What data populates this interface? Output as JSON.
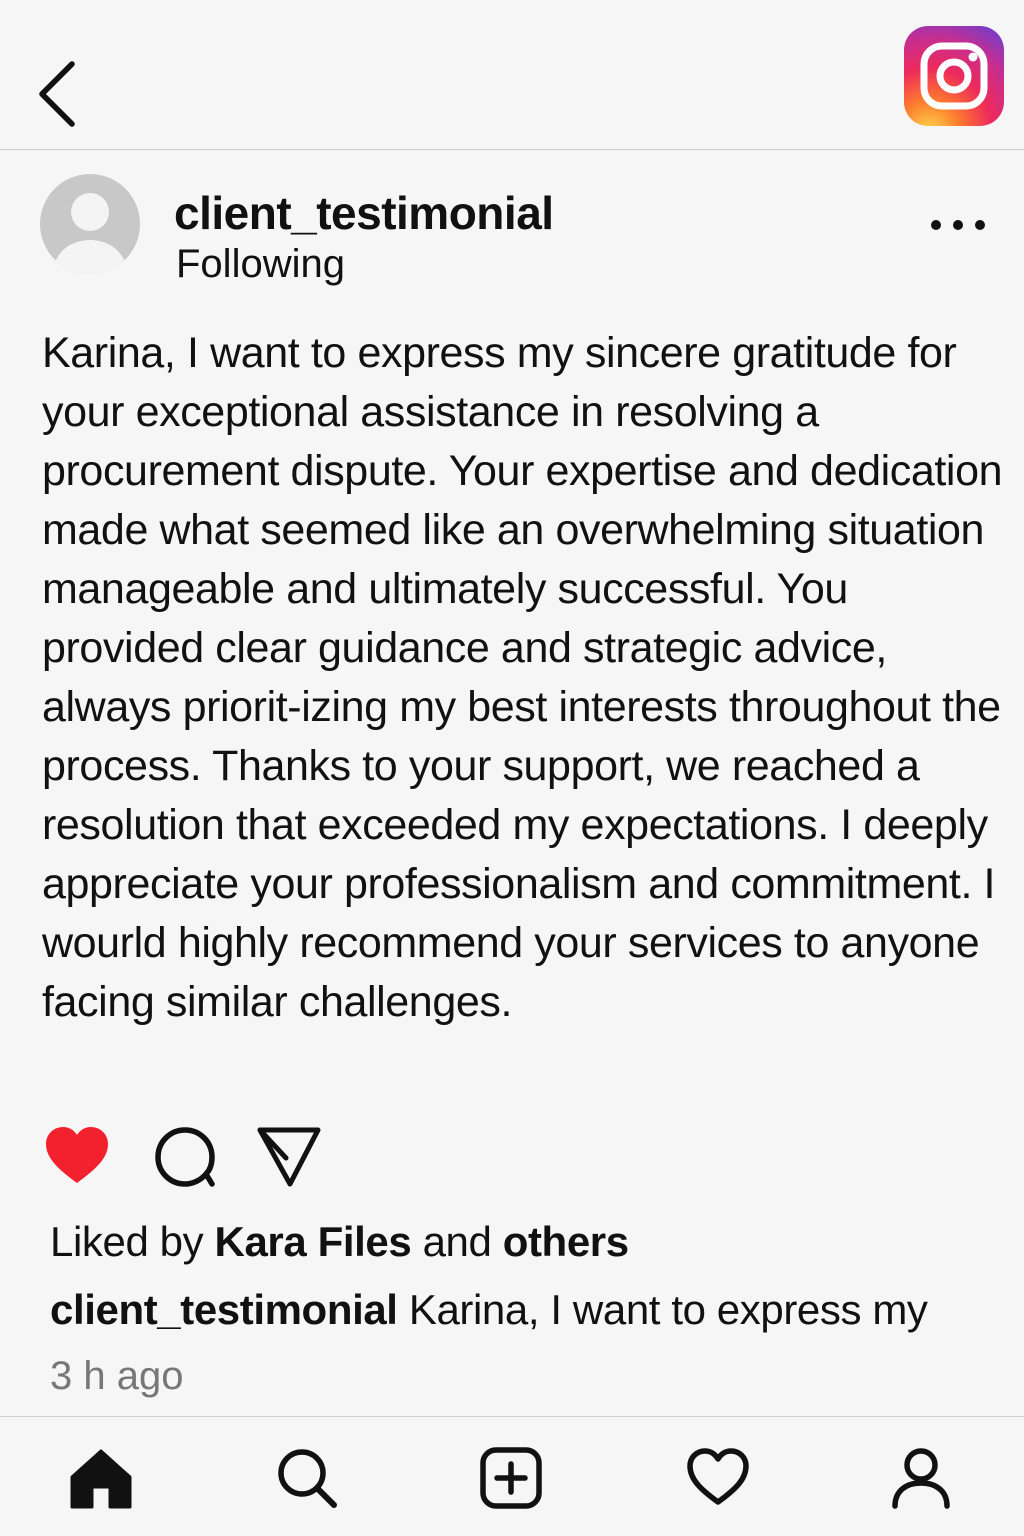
{
  "header": {
    "back_icon": "chevron-left-icon",
    "logo": "instagram-logo"
  },
  "post": {
    "username": "client_testimonial",
    "follow_status": "Following",
    "more_icon": "more-horizontal-icon",
    "caption": "Karina, I want to express my sincere gratitude for your exceptional assistance in resolving a procurement dispute. Your expertise and dedication made what seemed like an overwhelming situation manageable and ultimately successful. You provided clear guidance and strategic advice, always priorit-izing my best interests throughout the process. Thanks to your support, we reached a resolution that exceeded my expectations. I deeply appreciate your professionalism and commitment. I wourld highly recommend your services to anyone facing similar challenges.",
    "liked_prefix": "Liked by ",
    "liked_user": "Kara Files",
    "liked_middle": " and ",
    "liked_suffix": "others",
    "preview_username": "client_testimonial",
    "preview_text": " Karina, I want to express my",
    "timestamp": "3 h ago"
  },
  "actions": {
    "like_icon": "heart-filled-icon",
    "comment_icon": "comment-icon",
    "share_icon": "send-icon",
    "like_color": "#f3202e"
  },
  "bottom_nav": [
    "home-icon",
    "search-icon",
    "add-post-icon",
    "heart-icon",
    "profile-icon"
  ]
}
